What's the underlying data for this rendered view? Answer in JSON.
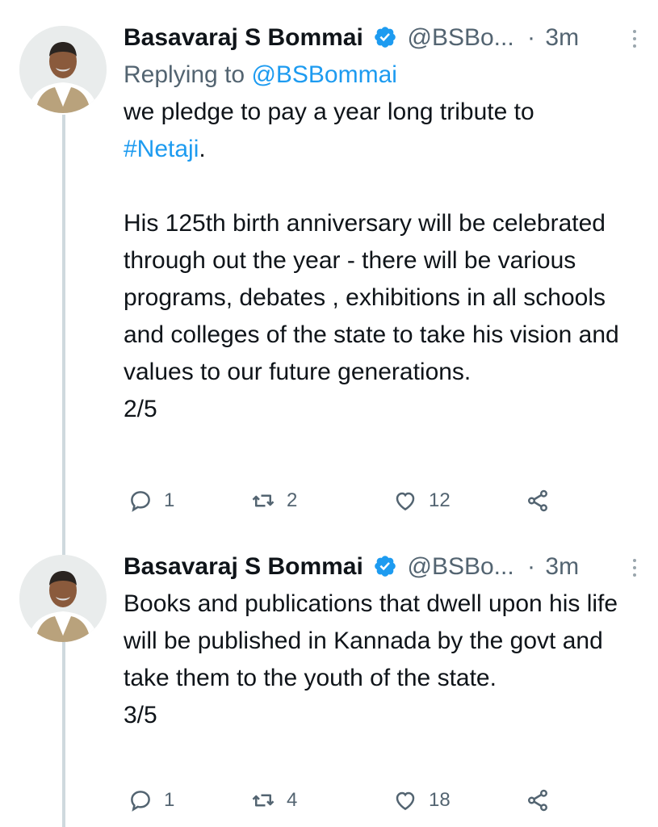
{
  "colors": {
    "accent": "#1d9bf0",
    "secondary_text": "#536471",
    "thread_line": "#cfd9de"
  },
  "tweets": [
    {
      "author": "Basavaraj S Bommai",
      "handle": "@BSBo...",
      "separator": "·",
      "time": "3m",
      "replying_label": "Replying to",
      "replying_handle": "@BSBommai",
      "text_line1": "we pledge to pay a year long tribute to",
      "hashtag": "#Netaji",
      "text_after_hashtag": ".",
      "paragraph2": "His 125th birth anniversary will be celebrated through out the year - there will be various programs, debates , exhibitions in all schools and colleges of the state to take his vision and values to our future generations.",
      "counter": "2/5",
      "replies": "1",
      "retweets": "2",
      "likes": "12"
    },
    {
      "author": "Basavaraj S Bommai",
      "handle": "@BSBo...",
      "separator": "·",
      "time": "3m",
      "paragraph1": "Books and publications that dwell upon his life will be published in Kannada by the govt and take them to the youth of the state.",
      "counter": "3/5",
      "replies": "1",
      "retweets": "4",
      "likes": "18"
    }
  ],
  "icons": {
    "verified": "verified-badge-icon",
    "more": "more-vertical-icon",
    "reply": "reply-bubble-icon",
    "retweet": "retweet-icon",
    "like": "heart-icon",
    "share": "share-icon"
  }
}
